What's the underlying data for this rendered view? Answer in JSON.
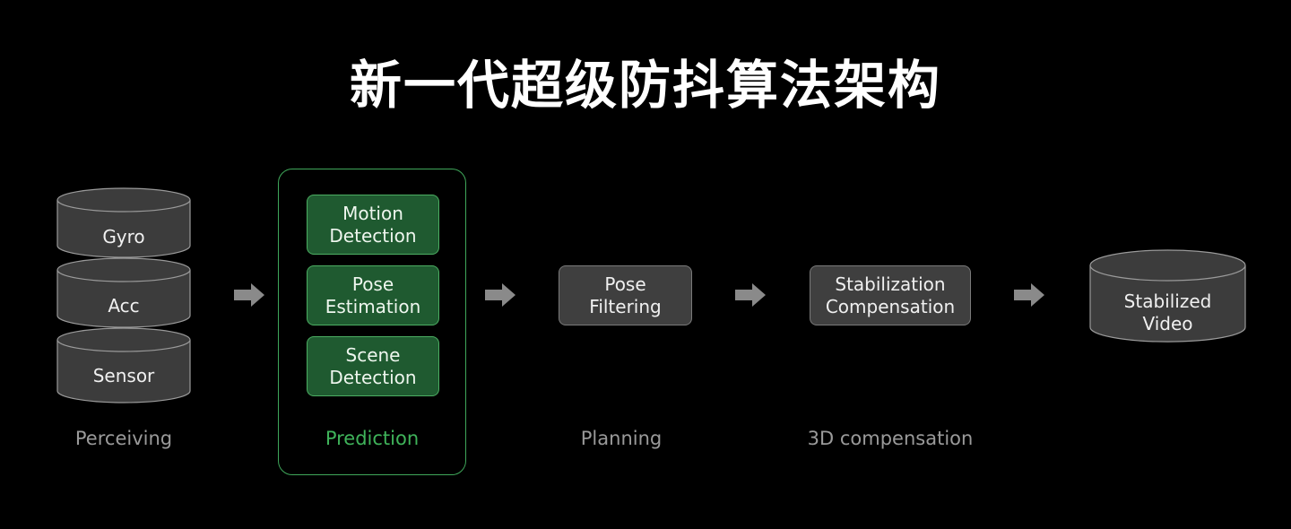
{
  "title": "新一代超级防抖算法架构",
  "colors": {
    "accent_green": "#3fb35a",
    "box_gray": "#3f3f3f",
    "box_green": "#1f5a30",
    "arrow": "#8a8a8a"
  },
  "perceiving": {
    "inputs": [
      "Gyro",
      "Acc",
      "Sensor"
    ]
  },
  "prediction": {
    "modules": [
      {
        "line1": "Motion",
        "line2": "Detection"
      },
      {
        "line1": "Pose",
        "line2": "Estimation"
      },
      {
        "line1": "Scene",
        "line2": "Detection"
      }
    ]
  },
  "planning": {
    "line1": "Pose",
    "line2": "Filtering"
  },
  "compensation": {
    "line1": "Stabilization",
    "line2": "Compensation"
  },
  "output": {
    "line1": "Stabilized",
    "line2": "Video"
  },
  "stages": [
    "Perceiving",
    "Prediction",
    "Planning",
    "3D compensation"
  ],
  "arrows": [
    "arrow-right-icon",
    "arrow-right-icon",
    "arrow-right-icon",
    "arrow-right-icon"
  ]
}
